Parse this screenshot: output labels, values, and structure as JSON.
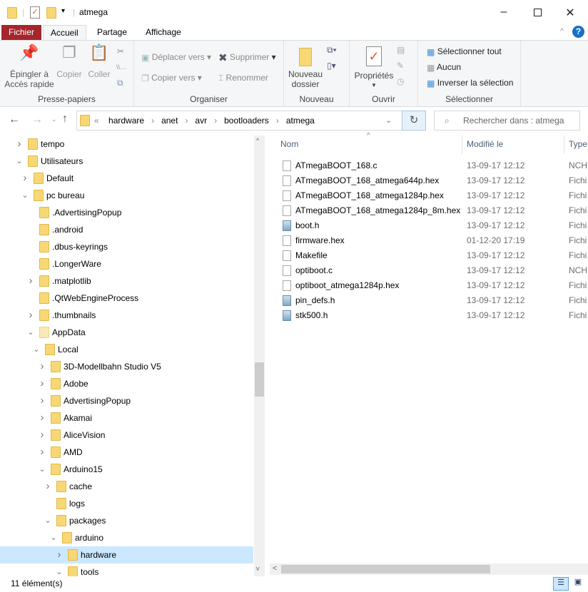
{
  "window": {
    "title": "atmega",
    "minimize_icon": "minimize-icon",
    "maximize_icon": "maximize-icon",
    "close_icon": "close-icon"
  },
  "tabs": [
    {
      "label": "Fichier"
    },
    {
      "label": "Accueil"
    },
    {
      "label": "Partage"
    },
    {
      "label": "Affichage"
    }
  ],
  "ribbon": {
    "clipboard": {
      "label": "Presse-papiers",
      "pin": "Épingler à Accès rapide",
      "copy": "Copier",
      "paste": "Coller"
    },
    "organize": {
      "label": "Organiser",
      "move": "Déplacer vers",
      "copy_to": "Copier vers",
      "delete": "Supprimer",
      "rename": "Renommer"
    },
    "new": {
      "label": "Nouveau",
      "new_folder": "Nouveau dossier"
    },
    "open": {
      "label": "Ouvrir",
      "properties": "Propriétés"
    },
    "select": {
      "label": "Sélectionner",
      "all": "Sélectionner tout",
      "none": "Aucun",
      "invert": "Inverser la sélection"
    }
  },
  "address": {
    "overflow": "«",
    "crumbs": [
      "hardware",
      "anet",
      "avr",
      "bootloaders",
      "atmega"
    ]
  },
  "search": {
    "placeholder": "Rechercher dans : atmega"
  },
  "tree": [
    {
      "label": "tempo",
      "level": 0,
      "exp": ">"
    },
    {
      "label": "Utilisateurs",
      "level": 0,
      "exp": "v"
    },
    {
      "label": "Default",
      "level": 1,
      "exp": ">"
    },
    {
      "label": "pc bureau",
      "level": 1,
      "exp": "v"
    },
    {
      "label": ".AdvertisingPopup",
      "level": 2,
      "exp": ""
    },
    {
      "label": ".android",
      "level": 2,
      "exp": ""
    },
    {
      "label": ".dbus-keyrings",
      "level": 2,
      "exp": ""
    },
    {
      "label": ".LongerWare",
      "level": 2,
      "exp": ""
    },
    {
      "label": ".matplotlib",
      "level": 2,
      "exp": ">"
    },
    {
      "label": ".QtWebEngineProcess",
      "level": 2,
      "exp": ""
    },
    {
      "label": ".thumbnails",
      "level": 2,
      "exp": ">"
    },
    {
      "label": "AppData",
      "level": 2,
      "exp": "v",
      "hidden": true
    },
    {
      "label": "Local",
      "level": 3,
      "exp": "v"
    },
    {
      "label": "3D-Modellbahn Studio V5",
      "level": 4,
      "exp": ">"
    },
    {
      "label": "Adobe",
      "level": 4,
      "exp": ">"
    },
    {
      "label": "AdvertisingPopup",
      "level": 4,
      "exp": ">"
    },
    {
      "label": "Akamai",
      "level": 4,
      "exp": ">"
    },
    {
      "label": "AliceVision",
      "level": 4,
      "exp": ">"
    },
    {
      "label": "AMD",
      "level": 4,
      "exp": ">"
    },
    {
      "label": "Arduino15",
      "level": 4,
      "exp": "v"
    },
    {
      "label": "cache",
      "level": 5,
      "exp": ">"
    },
    {
      "label": "logs",
      "level": 5,
      "exp": ""
    },
    {
      "label": "packages",
      "level": 5,
      "exp": "v"
    },
    {
      "label": "arduino",
      "level": 6,
      "exp": "v"
    },
    {
      "label": "hardware",
      "level": 7,
      "exp": ">",
      "selected": true
    },
    {
      "label": "tools",
      "level": 7,
      "exp": "v"
    }
  ],
  "columns": {
    "name": "Nom",
    "modified": "Modifié le",
    "type": "Type"
  },
  "files": [
    {
      "name": "ATmegaBOOT_168.c",
      "modified": "13-09-17 12:12",
      "type": "NCH",
      "icon": "file"
    },
    {
      "name": "ATmegaBOOT_168_atmega644p.hex",
      "modified": "13-09-17 12:12",
      "type": "Fichi",
      "icon": "file"
    },
    {
      "name": "ATmegaBOOT_168_atmega1284p.hex",
      "modified": "13-09-17 12:12",
      "type": "Fichi",
      "icon": "file"
    },
    {
      "name": "ATmegaBOOT_168_atmega1284p_8m.hex",
      "modified": "13-09-17 12:12",
      "type": "Fichi",
      "icon": "file"
    },
    {
      "name": "boot.h",
      "modified": "13-09-17 12:12",
      "type": "Fichi",
      "icon": "header"
    },
    {
      "name": "firmware.hex",
      "modified": "01-12-20 17:19",
      "type": "Fichi",
      "icon": "file"
    },
    {
      "name": "Makefile",
      "modified": "13-09-17 12:12",
      "type": "Fichi",
      "icon": "file"
    },
    {
      "name": "optiboot.c",
      "modified": "13-09-17 12:12",
      "type": "NCH",
      "icon": "file"
    },
    {
      "name": "optiboot_atmega1284p.hex",
      "modified": "13-09-17 12:12",
      "type": "Fichi",
      "icon": "file"
    },
    {
      "name": "pin_defs.h",
      "modified": "13-09-17 12:12",
      "type": "Fichi",
      "icon": "header"
    },
    {
      "name": "stk500.h",
      "modified": "13-09-17 12:12",
      "type": "Fichi",
      "icon": "header"
    }
  ],
  "status": {
    "count": "11 élément(s)"
  },
  "colors": {
    "file_tab": "#a4262c",
    "selection": "#cce8ff",
    "ribbon": "#f5f6f7",
    "help": "#1a6fc4"
  }
}
